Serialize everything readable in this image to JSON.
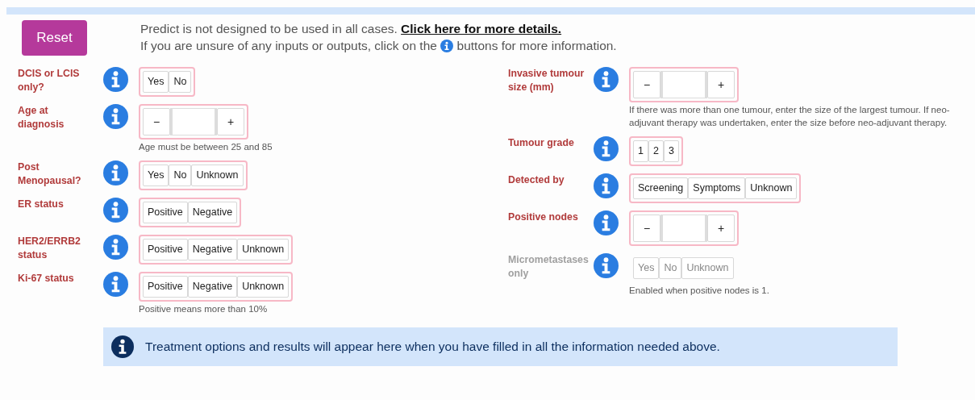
{
  "reset_button": "Reset",
  "notice": {
    "text": "Predict is not designed to be used in all cases.",
    "link": "Click here for more details.",
    "line2_before": "If you are unsure of any inputs or outputs, click on the",
    "line2_after": "buttons for more information."
  },
  "left_fields": [
    {
      "label": "DCIS or LCIS only?",
      "kind": "choice",
      "options": [
        "Yes",
        "No"
      ],
      "disabled": false
    },
    {
      "label": "Age at diagnosis",
      "kind": "stepper",
      "minus": "−",
      "plus": "+",
      "help": "Age must be between 25 and 85",
      "disabled": false
    },
    {
      "label": "Post Menopausal?",
      "kind": "choice",
      "options": [
        "Yes",
        "No",
        "Unknown"
      ],
      "disabled": false
    },
    {
      "label": "ER status",
      "kind": "choice",
      "options": [
        "Positive",
        "Negative"
      ],
      "disabled": false
    },
    {
      "label": "HER2/ERRB2 status",
      "kind": "choice",
      "options": [
        "Positive",
        "Negative",
        "Unknown"
      ],
      "disabled": false
    },
    {
      "label": "Ki-67 status",
      "kind": "choice",
      "options": [
        "Positive",
        "Negative",
        "Unknown"
      ],
      "help": "Positive means more than 10%",
      "disabled": false
    }
  ],
  "right_fields": [
    {
      "label": "Invasive tumour size (mm)",
      "kind": "stepper",
      "minus": "−",
      "plus": "+",
      "help": "If there was more than one tumour, enter the size of the largest tumour. If neo-adjuvant therapy was undertaken, enter the size before neo-adjuvant therapy.",
      "disabled": false
    },
    {
      "label": "Tumour grade",
      "kind": "choice",
      "options": [
        "1",
        "2",
        "3"
      ],
      "disabled": false
    },
    {
      "label": "Detected by",
      "kind": "choice",
      "options": [
        "Screening",
        "Symptoms",
        "Unknown"
      ],
      "disabled": false
    },
    {
      "label": "Positive nodes",
      "kind": "stepper",
      "minus": "−",
      "plus": "+",
      "disabled": false
    },
    {
      "label": "Micrometastases only",
      "kind": "choice",
      "options": [
        "Yes",
        "No",
        "Unknown"
      ],
      "help": "Enabled when positive nodes is 1.",
      "disabled": true
    }
  ],
  "alert": "Treatment options and results will appear here when you have filled in all the information needed above."
}
